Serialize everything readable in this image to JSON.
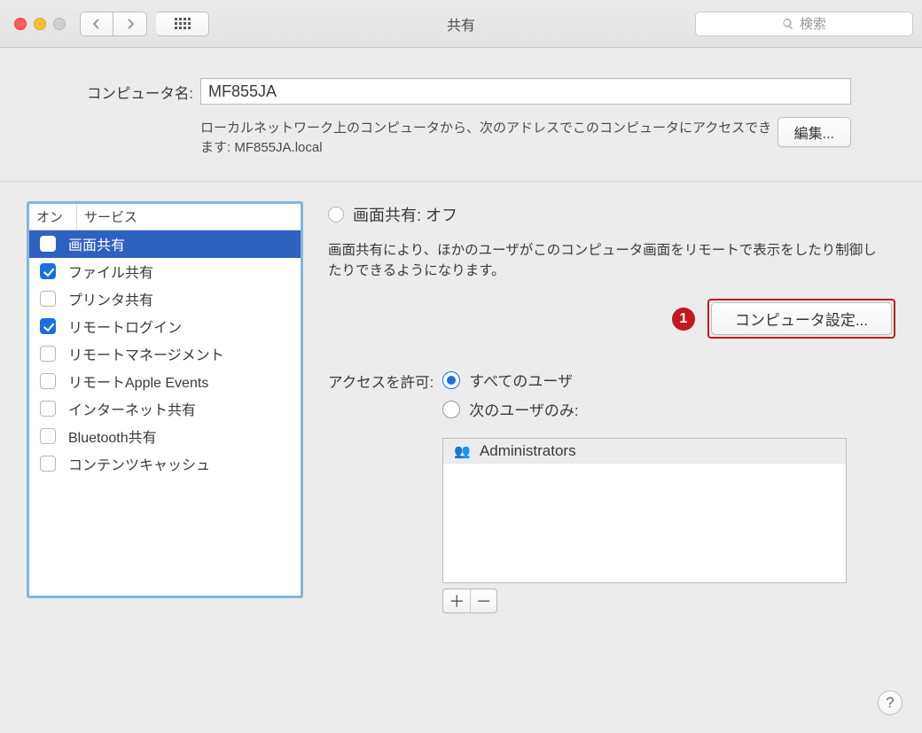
{
  "titlebar": {
    "title": "共有",
    "search_placeholder": "検索"
  },
  "top": {
    "computer_name_label": "コンピュータ名:",
    "computer_name_value": "MF855JA",
    "hint_text": "ローカルネットワーク上のコンピュータから、次のアドレスでこのコンピュータにアクセスできます: MF855JA.local",
    "edit_button": "編集..."
  },
  "services": {
    "header_on": "オン",
    "header_service": "サービス",
    "items": [
      {
        "label": "画面共有",
        "checked": false,
        "selected": true
      },
      {
        "label": "ファイル共有",
        "checked": true,
        "selected": false
      },
      {
        "label": "プリンタ共有",
        "checked": false,
        "selected": false
      },
      {
        "label": "リモートログイン",
        "checked": true,
        "selected": false
      },
      {
        "label": "リモートマネージメント",
        "checked": false,
        "selected": false
      },
      {
        "label": "リモートApple Events",
        "checked": false,
        "selected": false
      },
      {
        "label": "インターネット共有",
        "checked": false,
        "selected": false
      },
      {
        "label": "Bluetooth共有",
        "checked": false,
        "selected": false
      },
      {
        "label": "コンテンツキャッシュ",
        "checked": false,
        "selected": false
      }
    ]
  },
  "detail": {
    "status_title": "画面共有: オフ",
    "description": "画面共有により、ほかのユーザがこのコンピュータ画面をリモートで表示をしたり制御したりできるようになります。",
    "callout_number": "1",
    "settings_button": "コンピュータ設定...",
    "access_label": "アクセスを許可:",
    "radio_all": "すべてのユーザ",
    "radio_only": "次のユーザのみ:",
    "radio_selected": "all",
    "users": [
      {
        "name": "Administrators"
      }
    ]
  }
}
